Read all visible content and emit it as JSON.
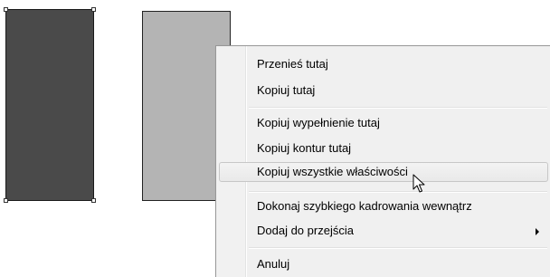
{
  "canvas": {
    "shapes": [
      {
        "name": "dark-rectangle",
        "fill": "#4a4a4a",
        "selected": true
      },
      {
        "name": "light-rectangle",
        "fill": "#b4b4b4",
        "selected": false
      }
    ]
  },
  "context_menu": {
    "items": [
      {
        "label": "Przenieś tutaj"
      },
      {
        "label": "Kopiuj tutaj"
      },
      {
        "label": "Kopiuj wypełnienie tutaj"
      },
      {
        "label": "Kopiuj kontur tutaj"
      },
      {
        "label": "Kopiuj wszystkie właściwości",
        "hovered": true
      },
      {
        "label": "Dokonaj szybkiego kadrowania wewnątrz"
      },
      {
        "label": "Dodaj do przejścia",
        "submenu": true
      },
      {
        "label": "Anuluj"
      }
    ]
  },
  "colors": {
    "menu_background": "#f0f0f0",
    "hover_border": "#c7c7c7"
  },
  "icons": {
    "cursor": "arrow-pointer-icon",
    "submenu": "chevron-right-icon"
  }
}
